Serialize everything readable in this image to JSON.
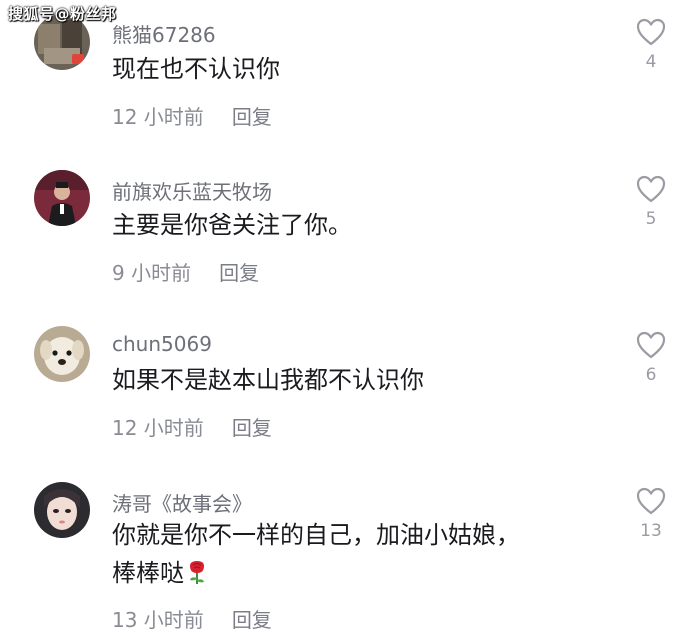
{
  "watermark": "搜狐号@粉丝邦",
  "comments": [
    {
      "username": "熊猫67286",
      "text": "现在也不认识你",
      "text2": "",
      "time": "12 小时前",
      "reply": "回复",
      "likes": "4"
    },
    {
      "username": "前旗欢乐蓝天牧场",
      "text": "主要是你爸关注了你。",
      "text2": "",
      "time": "9 小时前",
      "reply": "回复",
      "likes": "5"
    },
    {
      "username": "chun5069",
      "text": "如果不是赵本山我都不认识你",
      "text2": "",
      "time": "12 小时前",
      "reply": "回复",
      "likes": "6"
    },
    {
      "username": "涛哥《故事会》",
      "text": "你就是你不一样的自己，加油小姑娘，",
      "text2": "棒棒哒",
      "time": "13 小时前",
      "reply": "回复",
      "likes": "13",
      "emoji": "rose-icon"
    }
  ],
  "colors": {
    "username": "#6e7079",
    "meta": "#8a8c94",
    "heart": "#9a9ca4"
  }
}
